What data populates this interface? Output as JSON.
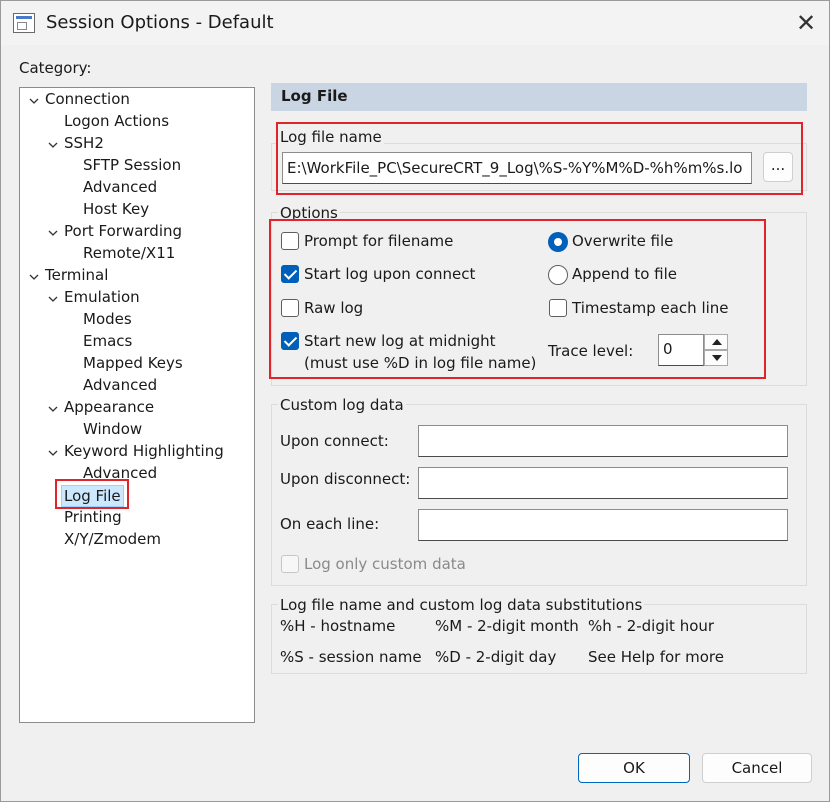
{
  "window": {
    "title": "Session Options - Default",
    "close_glyph": "✕"
  },
  "category_label": "Category:",
  "tree": {
    "items": [
      {
        "label": "Connection"
      },
      {
        "label": "Logon Actions"
      },
      {
        "label": "SSH2"
      },
      {
        "label": "SFTP Session"
      },
      {
        "label": "Advanced"
      },
      {
        "label": "Host Key"
      },
      {
        "label": "Port Forwarding"
      },
      {
        "label": "Remote/X11"
      },
      {
        "label": "Terminal"
      },
      {
        "label": "Emulation"
      },
      {
        "label": "Modes"
      },
      {
        "label": "Emacs"
      },
      {
        "label": "Mapped Keys"
      },
      {
        "label": "Advanced"
      },
      {
        "label": "Appearance"
      },
      {
        "label": "Window"
      },
      {
        "label": "Keyword Highlighting"
      },
      {
        "label": "Advanced"
      },
      {
        "label": "Log File"
      },
      {
        "label": "Printing"
      },
      {
        "label": "X/Y/Zmodem"
      }
    ],
    "selected": "Log File"
  },
  "panel": {
    "header": "Log File",
    "log_file_name": {
      "label": "Log file name",
      "value": "E:\\WorkFile_PC\\SecureCRT_9_Log\\%S-%Y%M%D-%h%m%s.lo",
      "browse_label": "..."
    },
    "options": {
      "label": "Options",
      "prompt_for_filename": {
        "label": "Prompt for filename",
        "checked": false
      },
      "start_log_upon_connect": {
        "label": "Start log upon connect",
        "checked": true
      },
      "raw_log": {
        "label": "Raw log",
        "checked": false
      },
      "start_new_log_at_midnight": {
        "label": "Start new log at midnight",
        "note": "(must use %D in log file name)",
        "checked": true
      },
      "overwrite_file": {
        "label": "Overwrite file",
        "selected": true
      },
      "append_to_file": {
        "label": "Append to file",
        "selected": false
      },
      "timestamp_each_line": {
        "label": "Timestamp each line",
        "checked": false
      },
      "trace_level": {
        "label": "Trace level:",
        "value": "0"
      }
    },
    "custom_log_data": {
      "label": "Custom log data",
      "upon_connect": {
        "label": "Upon connect:",
        "value": ""
      },
      "upon_disconnect": {
        "label": "Upon disconnect:",
        "value": ""
      },
      "on_each_line": {
        "label": "On each line:",
        "value": ""
      },
      "log_only_custom_data": {
        "label": "Log only custom data",
        "checked": false
      }
    },
    "substitutions": {
      "label": "Log file name and custom log data substitutions",
      "row1": [
        "%H - hostname",
        "%M - 2-digit month",
        "%h - 2-digit hour"
      ],
      "row2": [
        "%S - session name",
        "%D - 2-digit day",
        "See Help for more"
      ]
    }
  },
  "buttons": {
    "ok": "OK",
    "cancel": "Cancel"
  },
  "colors": {
    "accent": "#005fb8",
    "highlight_box": "#e0242c",
    "header_bg": "#c9d5e2",
    "selection_bg": "#cce8ff"
  },
  "icons": [
    "app-icon",
    "close-icon",
    "expand-chevron-icon",
    "spin-up-icon",
    "spin-down-icon"
  ]
}
